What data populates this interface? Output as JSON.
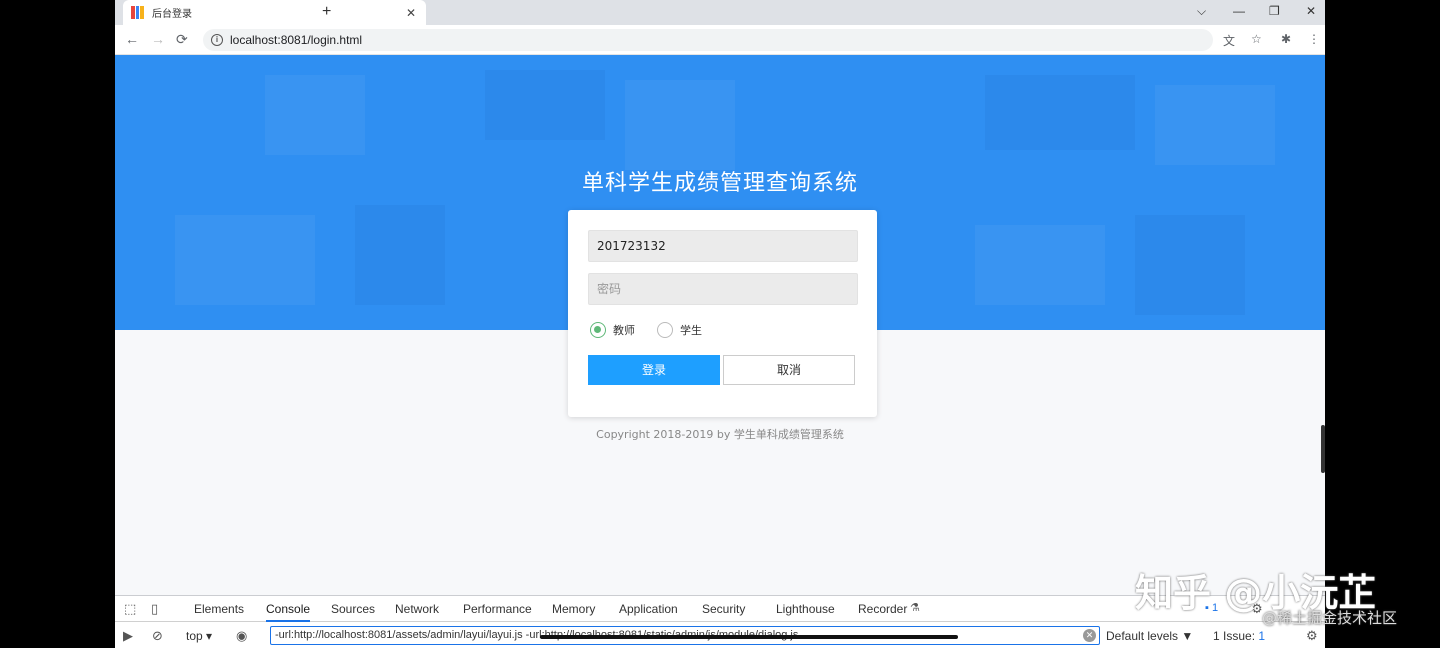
{
  "tab": {
    "title": "后台登录",
    "close": "✕",
    "new_tab": "+"
  },
  "window_controls": {
    "dropdown": "⌵",
    "minimize": "—",
    "restore": "❐",
    "close": "✕"
  },
  "nav": {
    "back": "←",
    "forward": "→",
    "reload": "⟳"
  },
  "address": {
    "url": "localhost:8081/login.html",
    "info": "i"
  },
  "login": {
    "title": "单科学生成绩管理查询系统",
    "username_value": "201723132",
    "password_placeholder": "密码",
    "roles": [
      "教师",
      "学生"
    ],
    "selected_role": "教师",
    "login_button": "登录",
    "cancel_button": "取消",
    "copyright": "Copyright 2018-2019 by 学生单科成绩管理系统"
  },
  "devtools": {
    "tabs": [
      "Elements",
      "Console",
      "Sources",
      "Network",
      "Performance",
      "Memory",
      "Application",
      "Security",
      "Lighthouse",
      "Recorder"
    ],
    "active_tab": "Console",
    "message_count": "1",
    "context": "top",
    "filter_text": "-url:http://localhost:8081/assets/admin/layui/layui.js -url:http://localhost:8081/static/admin/js/module/dialog.js",
    "levels": "Default levels ▼",
    "issues_label": "1 Issue:",
    "issues_count": "1"
  },
  "watermarks": {
    "zhihu": "知乎 @小沅芷",
    "juejin": "@稀土掘金技术社区"
  },
  "colors": {
    "banner": "#2f8ff2",
    "primary_button": "#1e9fff",
    "radio_selected": "#5fb878",
    "devtools_accent": "#1a73e8"
  }
}
